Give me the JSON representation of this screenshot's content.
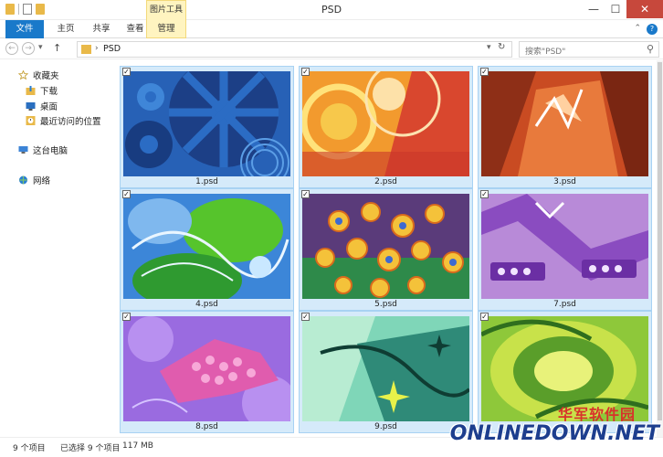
{
  "window": {
    "title": "PSD",
    "context_tab": "图片工具",
    "buttons": {
      "minimize": "—",
      "maximize": "☐",
      "close": "✕"
    }
  },
  "ribbon": {
    "tabs": [
      "文件",
      "主页",
      "共享",
      "查看",
      "管理"
    ],
    "help": "?",
    "collapse": "⌃"
  },
  "address": {
    "back": "←",
    "forward": "→",
    "history": "▾",
    "up": "↑",
    "chevron": "›",
    "path": "PSD",
    "dropdown": "▾",
    "refresh": "↻",
    "search_placeholder": "搜索\"PSD\"",
    "search_icon": "⚲"
  },
  "nav": {
    "items": [
      {
        "label": "收藏夹",
        "icon": "star-icon"
      },
      {
        "label": "下载",
        "icon": "download-folder-icon"
      },
      {
        "label": "桌面",
        "icon": "desktop-icon"
      },
      {
        "label": "最近访问的位置",
        "icon": "recent-places-icon"
      },
      {
        "label": "这台电脑",
        "icon": "computer-icon"
      },
      {
        "label": "网络",
        "icon": "network-icon"
      }
    ]
  },
  "files": [
    {
      "name": "1.psd",
      "checked": true
    },
    {
      "name": "2.psd",
      "checked": true
    },
    {
      "name": "3.psd",
      "checked": true
    },
    {
      "name": "4.psd",
      "checked": true
    },
    {
      "name": "5.psd",
      "checked": true
    },
    {
      "name": "7.psd",
      "checked": true
    },
    {
      "name": "8.psd",
      "checked": true
    },
    {
      "name": "9.psd",
      "checked": true
    },
    {
      "name": "",
      "checked": true
    }
  ],
  "checkmark": "✓",
  "status": {
    "item_count": "9 个项目",
    "selected": "已选择 9 个项目",
    "size": "117 MB"
  },
  "watermark": {
    "cn": "华军软件园",
    "en": "ONLINEDOWN.NET"
  },
  "colors": {
    "accent": "#1979ca",
    "selection": "#d5eafa",
    "selection_border": "#a8d2f3",
    "close": "#c7483c"
  }
}
